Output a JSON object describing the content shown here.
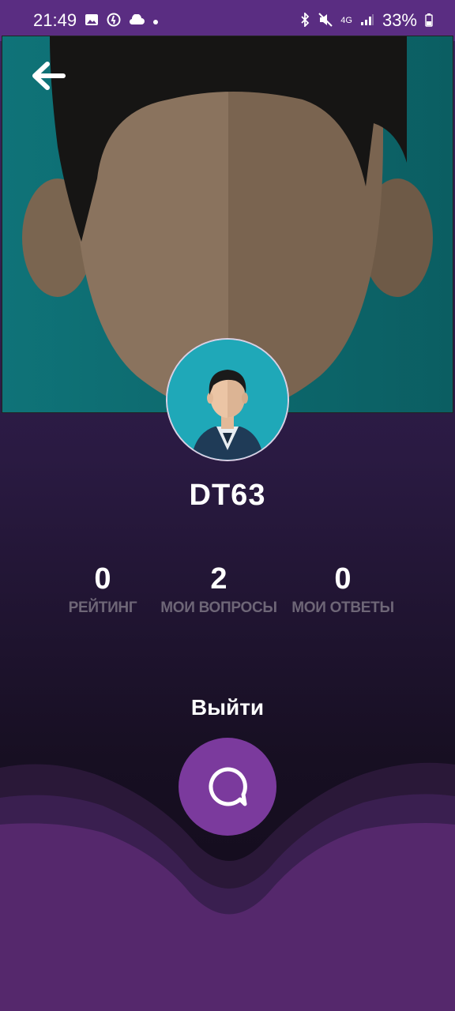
{
  "status_bar": {
    "time": "21:49",
    "network": "4G",
    "battery": "33%"
  },
  "profile": {
    "username": "DT63"
  },
  "stats": [
    {
      "value": "0",
      "label": "РЕЙТИНГ"
    },
    {
      "value": "2",
      "label": "МОИ ВОПРОСЫ"
    },
    {
      "value": "0",
      "label": "МОИ ОТВЕТЫ"
    }
  ],
  "actions": {
    "logout_label": "Выйти"
  },
  "colors": {
    "status_bar": "#5a2d82",
    "fab": "#7b3a9d",
    "wave": "#55286c",
    "cover_bg": "#0f6e72",
    "stat_label": "#6e6677"
  }
}
